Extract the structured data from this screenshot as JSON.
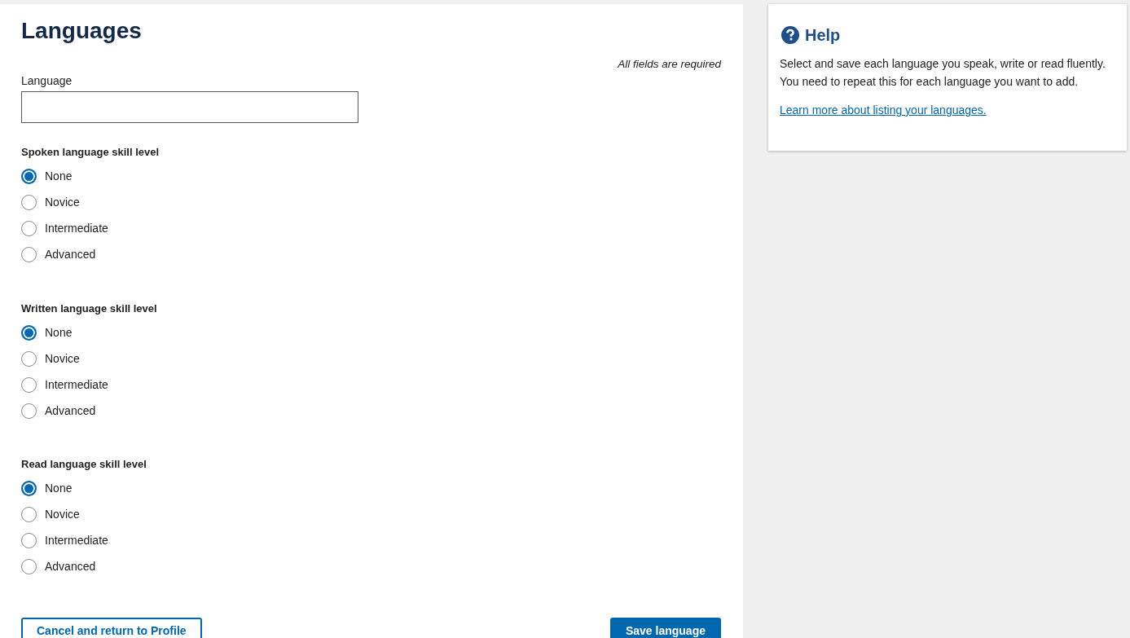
{
  "page_title": "Languages",
  "required_note": "All fields are required",
  "language_field": {
    "label": "Language"
  },
  "skill_groups": [
    {
      "legend": "Spoken language skill level",
      "options": [
        {
          "label": "None",
          "selected": true
        },
        {
          "label": "Novice",
          "selected": false
        },
        {
          "label": "Intermediate",
          "selected": false
        },
        {
          "label": "Advanced",
          "selected": false
        }
      ]
    },
    {
      "legend": "Written language skill level",
      "options": [
        {
          "label": "None",
          "selected": true
        },
        {
          "label": "Novice",
          "selected": false
        },
        {
          "label": "Intermediate",
          "selected": false
        },
        {
          "label": "Advanced",
          "selected": false
        }
      ]
    },
    {
      "legend": "Read language skill level",
      "options": [
        {
          "label": "None",
          "selected": true
        },
        {
          "label": "Novice",
          "selected": false
        },
        {
          "label": "Intermediate",
          "selected": false
        },
        {
          "label": "Advanced",
          "selected": false
        }
      ]
    }
  ],
  "buttons": [
    {
      "label": "Cancel and return to Profile",
      "kind": "secondary"
    },
    {
      "label": "Save language",
      "kind": "primary"
    }
  ],
  "help": {
    "title": "Help",
    "text": "Select and save each language you speak, write or read fluently. You need to repeat this for each language you want to add.",
    "link": "Learn more about listing your languages."
  }
}
